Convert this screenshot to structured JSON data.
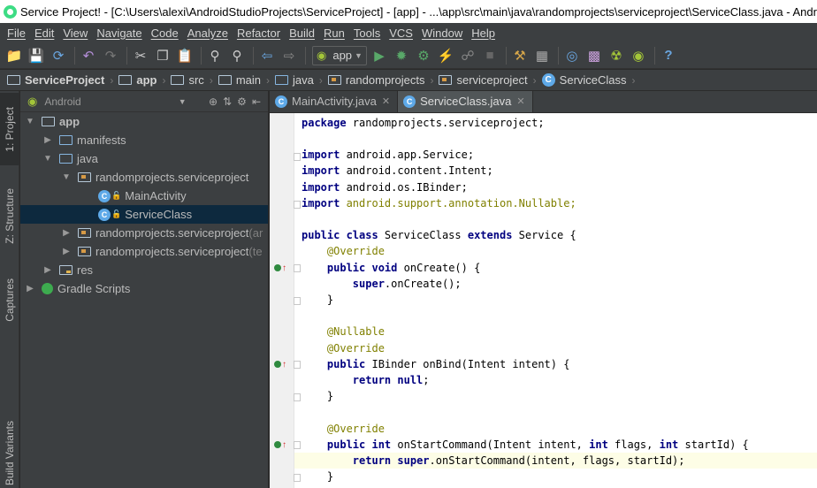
{
  "window": {
    "title": "Service Project! - [C:\\Users\\alexi\\AndroidStudioProjects\\ServiceProject] - [app] - ...\\app\\src\\main\\java\\randomprojects\\serviceproject\\ServiceClass.java - Andro"
  },
  "menu": [
    "File",
    "Edit",
    "View",
    "Navigate",
    "Code",
    "Analyze",
    "Refactor",
    "Build",
    "Run",
    "Tools",
    "VCS",
    "Window",
    "Help"
  ],
  "toolbar": {
    "run_config": "app",
    "icons": [
      "open-icon",
      "save-all-icon",
      "sync-icon",
      "undo-icon",
      "redo-icon",
      "cut-icon",
      "copy-icon",
      "paste-icon",
      "find-icon",
      "replace-icon",
      "back-icon",
      "forward-icon",
      "run-icon",
      "debug-icon",
      "attach-debugger-icon",
      "stop-icon",
      "project-structure-icon",
      "avd-manager-icon",
      "sdk-manager-icon",
      "android-monitor-icon",
      "help-icon"
    ]
  },
  "breadcrumbs": [
    "ServiceProject",
    "app",
    "src",
    "main",
    "java",
    "randomprojects",
    "serviceproject",
    "ServiceClass"
  ],
  "side_tabs": {
    "project": "1: Project",
    "structure": "Z: Structure",
    "captures": "Captures",
    "build_variants": "Build Variants"
  },
  "project_panel": {
    "view": "Android",
    "tree": {
      "app": "app",
      "manifests": "manifests",
      "java": "java",
      "pkg_main": "randomprojects.serviceproject",
      "main_activity": "MainActivity",
      "service_class": "ServiceClass",
      "pkg_android_test": "randomprojects.serviceproject",
      "pkg_android_test_suffix": " (ar",
      "pkg_test": "randomprojects.serviceproject",
      "pkg_test_suffix": " (te",
      "res": "res",
      "gradle_scripts": "Gradle Scripts"
    }
  },
  "editor": {
    "tabs": [
      {
        "label": "MainActivity.java",
        "active": false
      },
      {
        "label": "ServiceClass.java",
        "active": true
      }
    ],
    "code": {
      "package_kw": "package",
      "package_name": " randomprojects.serviceproject;",
      "import_kw": "import",
      "import_1": " android.app.Service;",
      "import_2": " android.content.Intent;",
      "import_3": " android.os.IBinder;",
      "import_4": " android.support.annotation.Nullable;",
      "class_kw": "public class",
      "class_name": " ServiceClass ",
      "extends_kw": "extends",
      "class_rest": " Service {",
      "override": "@Override",
      "nullable": "@Nullable",
      "public_void": "public void",
      "oncreate_sig": " onCreate() {",
      "super_kw": "super",
      "oncreate_body": ".onCreate();",
      "close_brace": "}",
      "public_kw": "public",
      "onbind_sig": " IBinder onBind(Intent intent) {",
      "return_null": "return null",
      "semicolon": ";",
      "public_int": "public int",
      "onstart_sig_1": " onStartCommand(Intent intent, ",
      "int_kw": "int",
      "onstart_sig_2": " flags, ",
      "onstart_sig_3": " startId) {",
      "return_kw": "return",
      "onstart_body": ".onStartCommand(intent, flags, startId);"
    }
  }
}
